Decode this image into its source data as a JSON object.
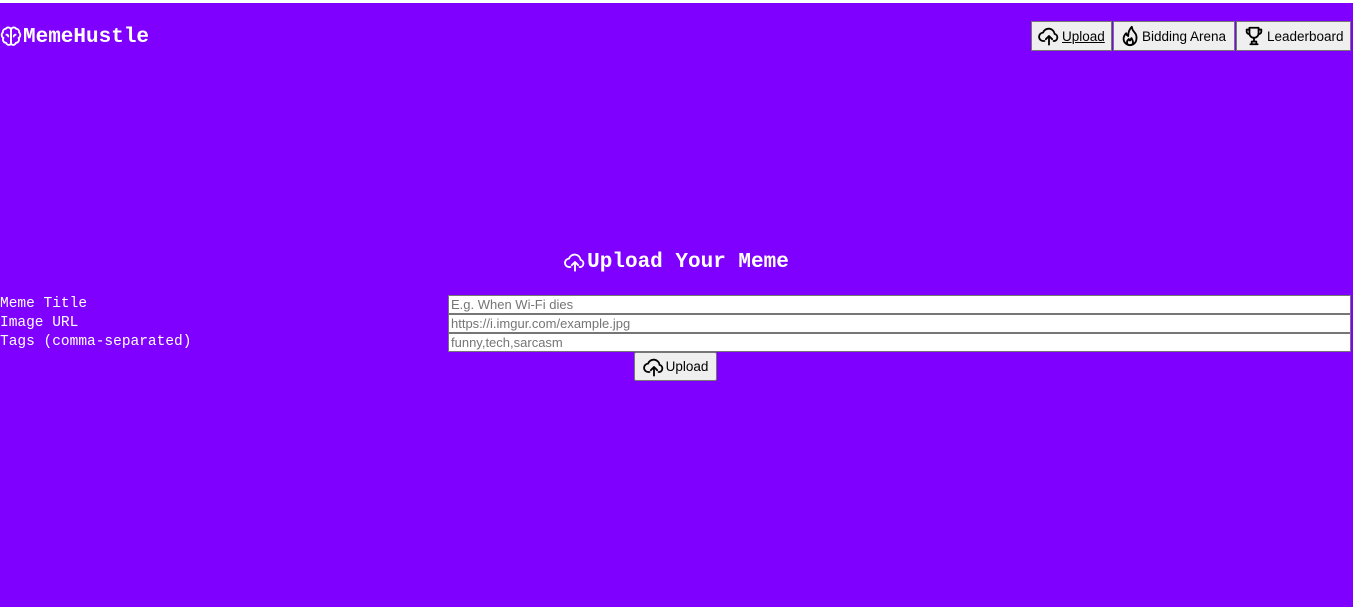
{
  "header": {
    "brand": "MemeHustle",
    "brand_icon": "brain-icon",
    "nav": [
      {
        "label": "Upload",
        "icon": "cloud-upload-icon",
        "active": true
      },
      {
        "label": "Bidding Arena",
        "icon": "flame-icon"
      },
      {
        "label": "Leaderboard",
        "icon": "trophy-icon"
      }
    ]
  },
  "main": {
    "heading": "Upload Your Meme",
    "heading_icon": "cloud-upload-icon",
    "form": {
      "fields": [
        {
          "label": "Meme Title",
          "placeholder": "E.g. When Wi-Fi dies",
          "value": ""
        },
        {
          "label": "Image URL",
          "placeholder": "https://i.imgur.com/example.jpg",
          "value": ""
        },
        {
          "label": "Tags (comma-separated)",
          "placeholder": "funny,tech,sarcasm",
          "value": ""
        }
      ],
      "submit_label": "Upload",
      "submit_icon": "cloud-upload-icon"
    }
  },
  "colors": {
    "background": "#7f00ff",
    "text": "#ffffff",
    "button_bg": "#efefef",
    "border": "#767676"
  }
}
